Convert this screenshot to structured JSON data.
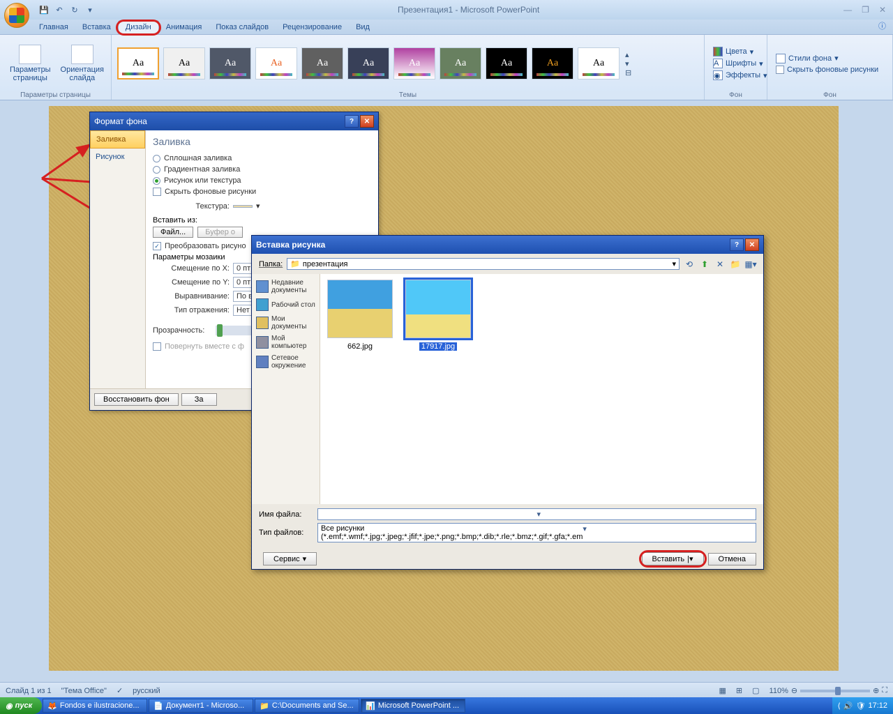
{
  "app_title": "Презентация1 - Microsoft PowerPoint",
  "tabs": [
    "Главная",
    "Вставка",
    "Дизайн",
    "Анимация",
    "Показ слайдов",
    "Рецензирование",
    "Вид"
  ],
  "active_tab_index": 2,
  "ribbon": {
    "group1_label": "Параметры страницы",
    "btn_page_setup": "Параметры страницы",
    "btn_orientation": "Ориентация слайда",
    "group2_label": "Темы",
    "group3_label": "Фон",
    "colors": "Цвета",
    "fonts": "Шрифты",
    "effects": "Эффекты",
    "bg_styles": "Стили фона",
    "hide_bg": "Скрыть фоновые рисунки"
  },
  "dlg1": {
    "title": "Формат фона",
    "nav": [
      "Заливка",
      "Рисунок"
    ],
    "heading": "Заливка",
    "r_solid": "Сплошная заливка",
    "r_gradient": "Градиентная заливка",
    "r_picture": "Рисунок или текстура",
    "chk_hide": "Скрыть фоновые рисунки",
    "lbl_texture": "Текстура:",
    "lbl_insert_from": "Вставить из:",
    "btn_file": "Файл...",
    "btn_clip": "Буфер о",
    "chk_tile": "Преобразовать рисуно",
    "grp_tile": "Параметры мозаики",
    "lbl_offx": "Смещение по X:",
    "lbl_offy": "Смещение по Y:",
    "lbl_align": "Выравнивание:",
    "lbl_mirror": "Тип отражения:",
    "lbl_trans": "Прозрачность:",
    "chk_rotate": "Повернуть вместе с ф",
    "val_offx": "0 пт",
    "val_offy": "0 пт",
    "val_align": "По ве",
    "val_mirror": "Нет",
    "btn_reset": "Восстановить фон",
    "btn_close": "За"
  },
  "dlg2": {
    "title": "Вставка рисунка",
    "lbl_folder": "Папка:",
    "folder": "презентация",
    "places": [
      "Недавние документы",
      "Рабочий стол",
      "Мои документы",
      "Мой компьютер",
      "Сетевое окружение"
    ],
    "files": [
      {
        "name": "662.jpg",
        "selected": false
      },
      {
        "name": "17917.jpg",
        "selected": true
      }
    ],
    "lbl_name": "Имя файла:",
    "lbl_type": "Тип файлов:",
    "type_value": "Все рисунки (*.emf;*.wmf;*.jpg;*.jpeg;*.jfif;*.jpe;*.png;*.bmp;*.dib;*.rle;*.bmz;*.gif;*.gfa;*.em",
    "btn_tools": "Сервис",
    "btn_insert": "Вставить",
    "btn_cancel": "Отмена"
  },
  "status": {
    "slide": "Слайд 1 из 1",
    "theme": "\"Тема Office\"",
    "lang": "русский",
    "zoom": "110%"
  },
  "taskbar": {
    "start": "пуск",
    "tasks": [
      "Fondos e ilustracione...",
      "Документ1 - Microso...",
      "C:\\Documents and Se...",
      "Microsoft PowerPoint ..."
    ],
    "time": "17:12"
  }
}
